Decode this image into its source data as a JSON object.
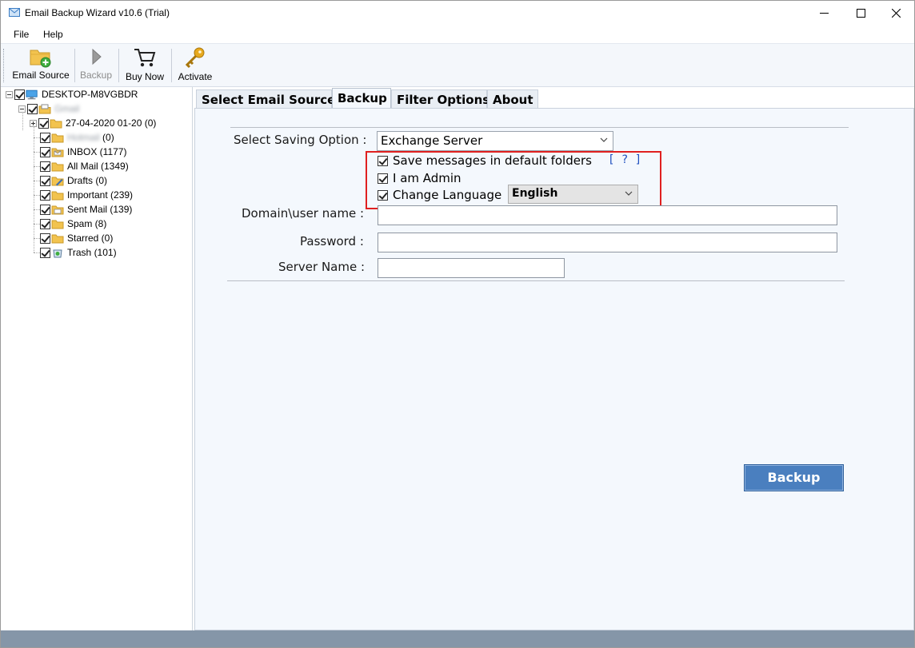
{
  "window": {
    "title": "Email Backup Wizard v10.6 (Trial)"
  },
  "menu": {
    "file": "File",
    "help": "Help"
  },
  "toolbar": {
    "email_source": "Email Source",
    "backup": "Backup",
    "buy_now": "Buy Now",
    "activate": "Activate"
  },
  "tree": {
    "root": "DESKTOP-M8VGBDR",
    "account": "Gmail",
    "items": [
      {
        "label": "27-04-2020 01-20 (0)"
      },
      {
        "label": "Hotmail (0)"
      },
      {
        "label": "INBOX (1177)"
      },
      {
        "label": "All Mail (1349)"
      },
      {
        "label": "Drafts (0)"
      },
      {
        "label": "Important (239)"
      },
      {
        "label": "Sent Mail (139)"
      },
      {
        "label": "Spam (8)"
      },
      {
        "label": "Starred (0)"
      },
      {
        "label": "Trash (101)"
      }
    ]
  },
  "tabs": [
    {
      "label": "Select Email Source"
    },
    {
      "label": "Backup"
    },
    {
      "label": "Filter Options"
    },
    {
      "label": "About"
    }
  ],
  "form": {
    "saving_option_label": "Select Saving Option :",
    "saving_option_value": "Exchange Server",
    "save_default_folders": "Save messages in default folders",
    "help_link": "[ ? ]",
    "i_am_admin": "I am Admin",
    "change_language": "Change Language",
    "language_value": "English",
    "domain_label": "Domain\\user name :",
    "password_label": "Password :",
    "server_label": "Server Name :",
    "backup_button": "Backup"
  },
  "colors": {
    "highlight": "#e02020",
    "accent_button": "#4a7fbf",
    "status_bar": "#8596a8"
  }
}
